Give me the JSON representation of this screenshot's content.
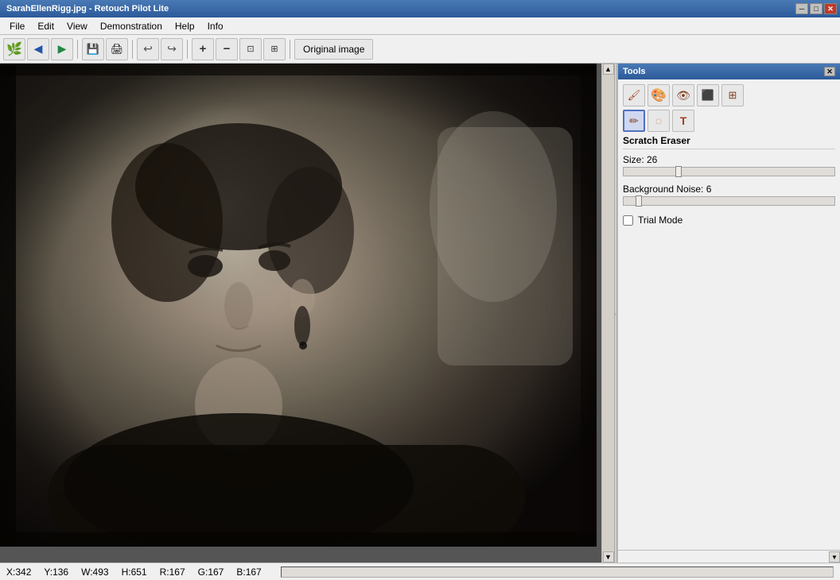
{
  "window": {
    "title": "SarahEllenRigg.jpg - Retouch Pilot Lite",
    "title_short": "SarahEllenRigg.jpg - Retouch Pilot Lite"
  },
  "title_controls": {
    "minimize": "─",
    "restore": "□",
    "close": "✕"
  },
  "menu": {
    "items": [
      "File",
      "Edit",
      "View",
      "Demonstration",
      "Help",
      "Info"
    ]
  },
  "toolbar": {
    "buttons": [
      {
        "name": "new",
        "icon": "🌿",
        "label": "New"
      },
      {
        "name": "back",
        "icon": "◀",
        "label": "Back"
      },
      {
        "name": "forward",
        "icon": "▶",
        "label": "Forward"
      },
      {
        "name": "save",
        "icon": "💾",
        "label": "Save"
      },
      {
        "name": "print",
        "icon": "🖨",
        "label": "Print"
      },
      {
        "name": "undo",
        "icon": "↩",
        "label": "Undo"
      },
      {
        "name": "redo",
        "icon": "↪",
        "label": "Redo"
      },
      {
        "name": "zoom-in",
        "icon": "+",
        "label": "Zoom In"
      },
      {
        "name": "zoom-out",
        "icon": "−",
        "label": "Zoom Out"
      },
      {
        "name": "zoom-fit",
        "icon": "⊡",
        "label": "Zoom Fit"
      },
      {
        "name": "zoom-actual",
        "icon": "⊞",
        "label": "Zoom Actual"
      }
    ],
    "original_label": "Original image"
  },
  "tools_panel": {
    "title": "Tools",
    "close_btn": "✕",
    "tool_rows": [
      [
        {
          "name": "brush",
          "icon": "🖌",
          "active": false
        },
        {
          "name": "color-replace",
          "icon": "🎨",
          "active": false
        },
        {
          "name": "clone",
          "icon": "👁",
          "active": false
        },
        {
          "name": "patch",
          "icon": "⬜",
          "active": false
        },
        {
          "name": "grid",
          "icon": "⊞",
          "active": false
        }
      ],
      [
        {
          "name": "scratch-eraser",
          "icon": "✏",
          "active": true
        },
        {
          "name": "blur",
          "icon": "◌",
          "active": false
        },
        {
          "name": "text",
          "icon": "T",
          "active": false
        }
      ]
    ],
    "section_title": "Scratch Eraser",
    "size_label": "Size: 26",
    "size_value": 26,
    "size_min": 1,
    "size_max": 100,
    "size_position": 0.1,
    "bg_noise_label": "Background Noise: 6",
    "bg_noise_value": 6,
    "bg_noise_min": 0,
    "bg_noise_max": 100,
    "bg_noise_position": 0.05,
    "trial_mode_label": "Trial Mode",
    "trial_mode_checked": false
  },
  "status_bar": {
    "x_label": "X:",
    "x_value": "342",
    "y_label": "Y:",
    "y_value": "136",
    "w_label": "W:",
    "w_value": "493",
    "h_label": "H:",
    "h_value": "651",
    "r_label": "R:",
    "r_value": "167",
    "g_label": "G:",
    "g_value": "167",
    "b_label": "B:",
    "b_value": "167"
  }
}
